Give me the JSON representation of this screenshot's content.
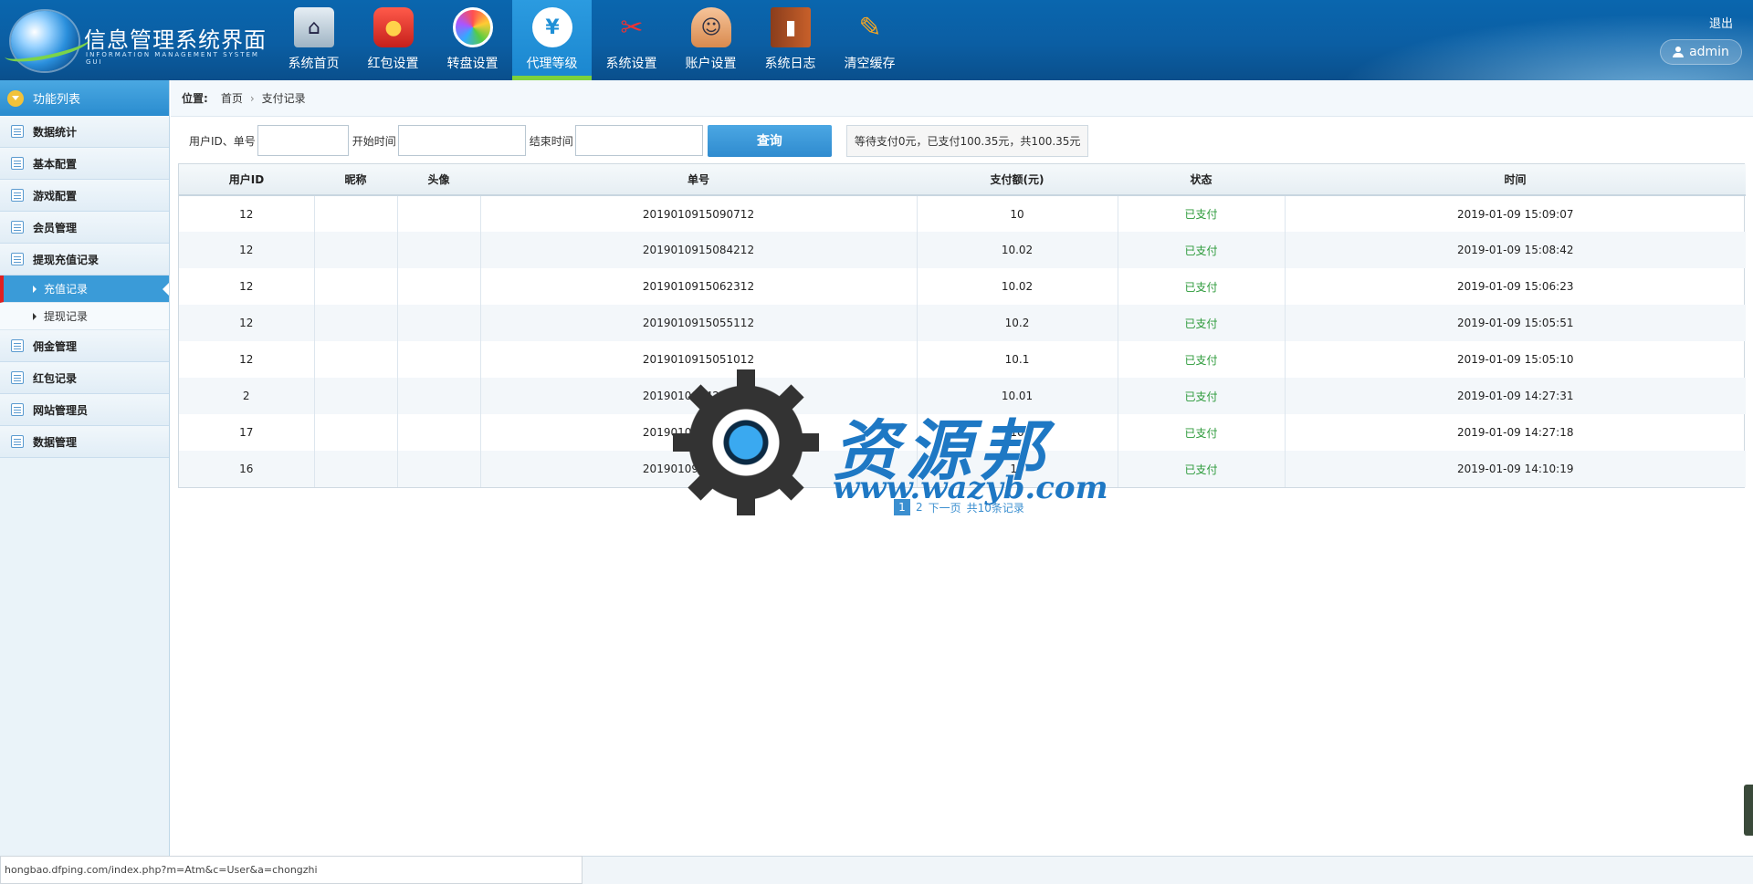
{
  "logo": {
    "title": "信息管理系统界面",
    "subtitle": "INFORMATION MANAGEMENT SYSTEM GUI"
  },
  "nav": [
    {
      "label": "系统首页",
      "icon": "home-icon"
    },
    {
      "label": "红包设置",
      "icon": "red-packet-icon"
    },
    {
      "label": "转盘设置",
      "icon": "wheel-icon"
    },
    {
      "label": "代理等级",
      "icon": "cloud-yen-icon",
      "active": true
    },
    {
      "label": "系统设置",
      "icon": "tools-icon"
    },
    {
      "label": "账户设置",
      "icon": "user-icon"
    },
    {
      "label": "系统日志",
      "icon": "book-icon"
    },
    {
      "label": "清空缓存",
      "icon": "clean-icon"
    }
  ],
  "header": {
    "logout": "退出",
    "username": "admin"
  },
  "sidebar": {
    "title": "功能列表",
    "items": [
      {
        "label": "数据统计"
      },
      {
        "label": "基本配置"
      },
      {
        "label": "游戏配置"
      },
      {
        "label": "会员管理"
      },
      {
        "label": "提现充值记录"
      }
    ],
    "subitems": [
      {
        "label": "充值记录",
        "active": true
      },
      {
        "label": "提现记录"
      }
    ],
    "items_after": [
      {
        "label": "佣金管理"
      },
      {
        "label": "红包记录"
      },
      {
        "label": "网站管理员"
      },
      {
        "label": "数据管理"
      }
    ]
  },
  "breadcrumb": {
    "label": "位置:",
    "home": "首页",
    "current": "支付记录"
  },
  "filters": {
    "id_label": "用户ID、单号",
    "start_label": "开始时间",
    "end_label": "结束时间",
    "search_button": "查询",
    "summary": "等待支付0元，已支付100.35元，共100.35元"
  },
  "table": {
    "headers": [
      "用户ID",
      "昵称",
      "头像",
      "单号",
      "支付额(元)",
      "状态",
      "时间"
    ],
    "rows": [
      [
        "12",
        "",
        "",
        "2019010915090712",
        "10",
        "已支付",
        "2019-01-09 15:09:07"
      ],
      [
        "12",
        "",
        "",
        "2019010915084212",
        "10.02",
        "已支付",
        "2019-01-09 15:08:42"
      ],
      [
        "12",
        "",
        "",
        "2019010915062312",
        "10.02",
        "已支付",
        "2019-01-09 15:06:23"
      ],
      [
        "12",
        "",
        "",
        "2019010915055112",
        "10.2",
        "已支付",
        "2019-01-09 15:05:51"
      ],
      [
        "12",
        "",
        "",
        "2019010915051012",
        "10.1",
        "已支付",
        "2019-01-09 15:05:10"
      ],
      [
        "2",
        "",
        "",
        "2019010914273102",
        "10.01",
        "已支付",
        "2019-01-09 14:27:31"
      ],
      [
        "17",
        "",
        "",
        "2019010914271817",
        "10",
        "已支付",
        "2019-01-09 14:27:18"
      ],
      [
        "16",
        "",
        "",
        "2019010914101916",
        "10",
        "已支付",
        "2019-01-09 14:10:19"
      ]
    ]
  },
  "pager": {
    "current": "1",
    "page2": "2",
    "next": "下一页",
    "total": "共10条记录"
  },
  "watermark": {
    "title": "资源邦",
    "url": "www.wazyb.com"
  },
  "statusbar": {
    "url": "hongbao.dfping.com/index.php?m=Atm&c=User&a=chongzhi"
  },
  "colors": {
    "header": "#0b5ea3",
    "accent": "#3a9bd8",
    "paid": "#2c9a3a",
    "active_marker": "#7cd13c"
  }
}
